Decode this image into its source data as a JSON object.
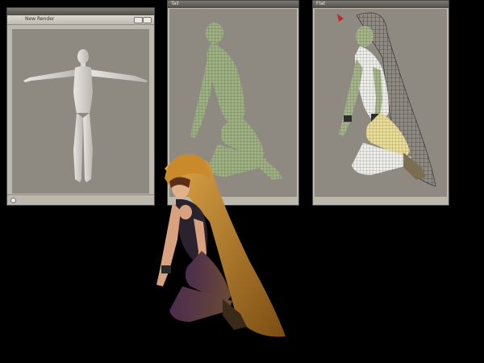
{
  "windows": {
    "left": {
      "toolbar_label": "New Render",
      "icon_strip": [
        "lights",
        "sphere-active",
        "sphere",
        "sphere",
        "sphere",
        "sphere",
        "sphere",
        "sphere",
        "sphere",
        "sphere",
        "sphere"
      ]
    },
    "middle": {
      "title": "Tail"
    },
    "right": {
      "title": "Flat"
    }
  },
  "colors": {
    "viewport_bg": "#8e8a82",
    "panel_bg": "#bdb8ae",
    "wire_green": "#6f8f5a",
    "cloak_orange": "#c98a2b"
  }
}
